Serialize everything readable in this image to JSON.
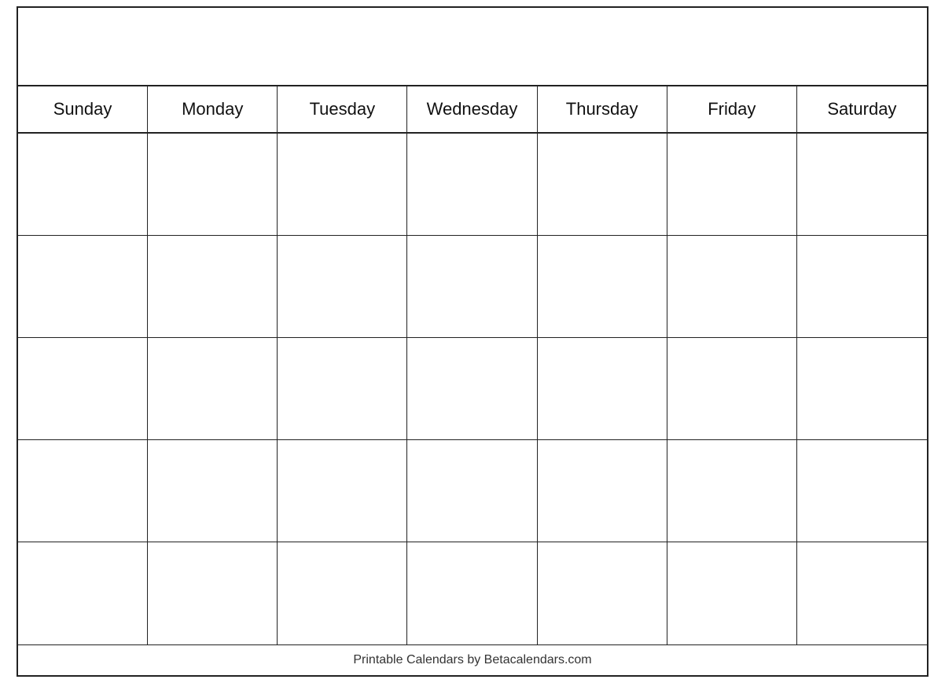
{
  "calendar": {
    "days": [
      "Sunday",
      "Monday",
      "Tuesday",
      "Wednesday",
      "Thursday",
      "Friday",
      "Saturday"
    ],
    "rows": 5,
    "footer": "Printable Calendars by Betacalendars.com"
  }
}
